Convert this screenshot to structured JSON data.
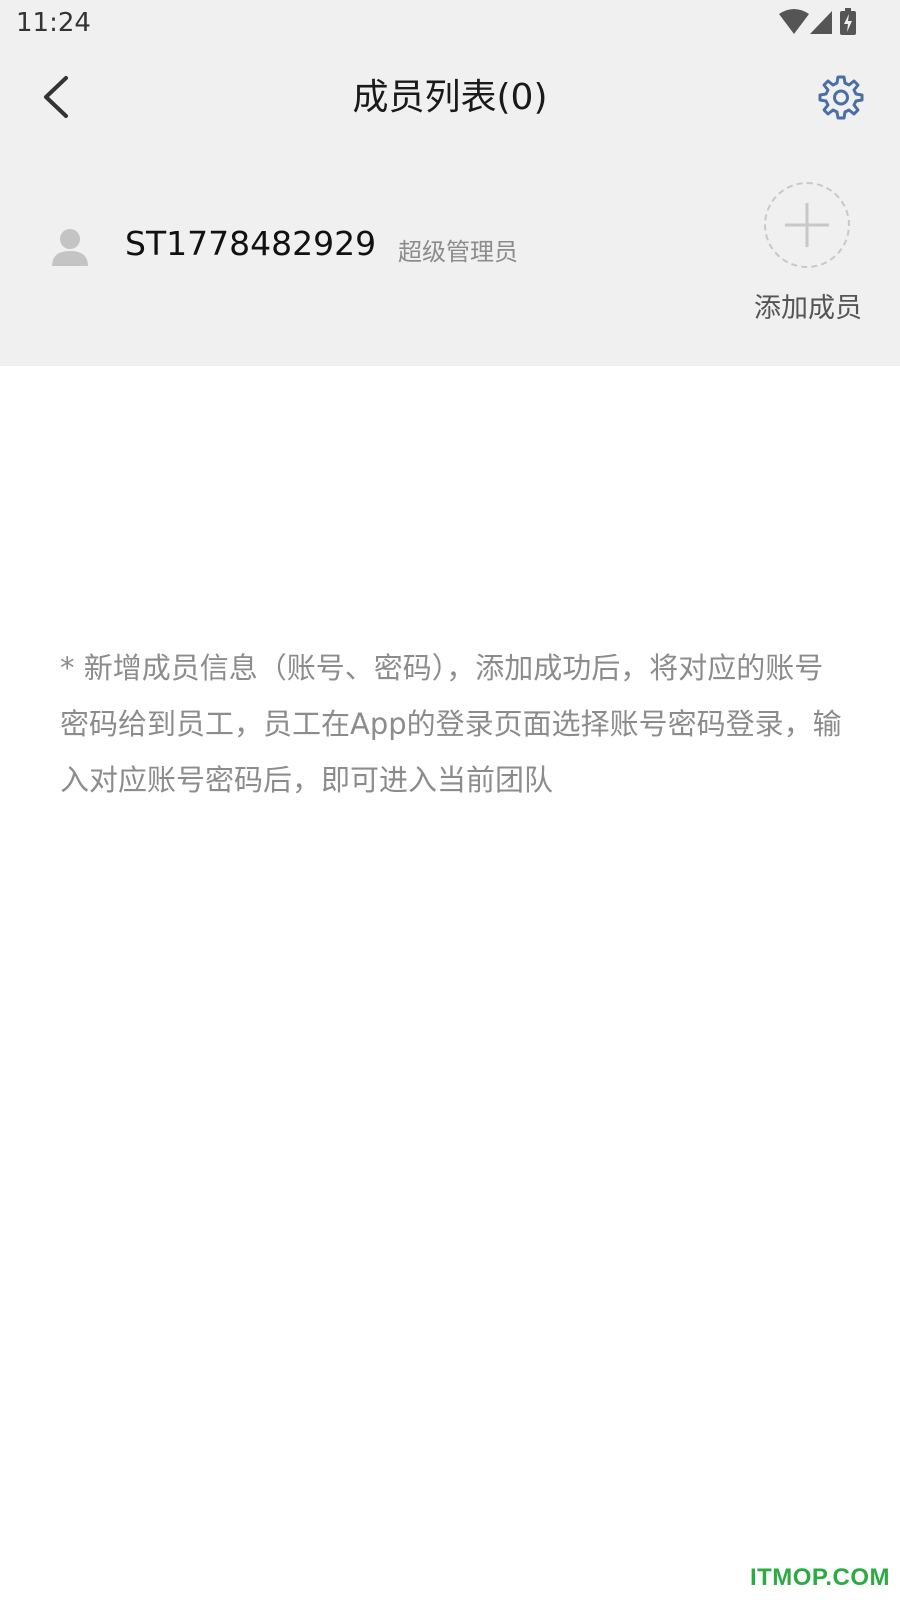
{
  "status_bar": {
    "time": "11:24",
    "icons": [
      "wifi-icon",
      "signal-icon",
      "battery-charging-icon"
    ]
  },
  "header": {
    "title": "成员列表(0)",
    "back_icon": "chevron-left-icon",
    "settings_icon": "gear-icon",
    "accent_color": "#4a6fa5"
  },
  "member": {
    "id": "ST1778482929",
    "role": "超级管理员",
    "avatar_icon": "user-silhouette-icon"
  },
  "add_member": {
    "label": "添加成员",
    "icon": "plus-icon"
  },
  "note": {
    "text": "* 新增成员信息（账号、密码），添加成功后，将对应的账号密码给到员工，员工在App的登录页面选择账号密码登录，输入对应账号密码后，即可进入当前团队"
  },
  "watermark": {
    "text": "ITMOP.COM",
    "color": "#2eaa44"
  }
}
